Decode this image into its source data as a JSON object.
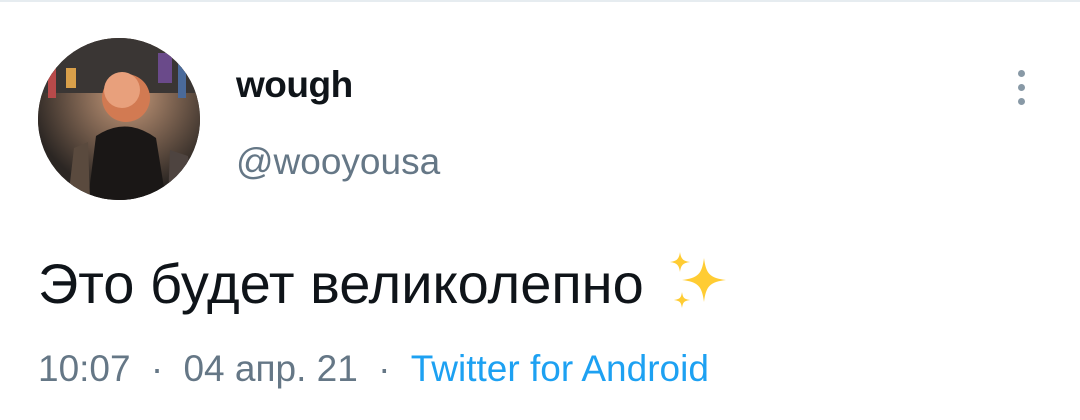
{
  "tweet": {
    "author": {
      "display_name": "wough",
      "handle": "@wooyousa",
      "avatar_icon": "avatar-photo"
    },
    "text": "Это будет великолепно",
    "emoji": "sparkles-icon",
    "time": "10:07",
    "date": "04 апр. 21",
    "separator": "·",
    "source": "Twitter for Android"
  },
  "colors": {
    "text_primary": "#0f1419",
    "text_secondary": "#657786",
    "link": "#1da1f2",
    "sparkle": "#ffcc33"
  }
}
